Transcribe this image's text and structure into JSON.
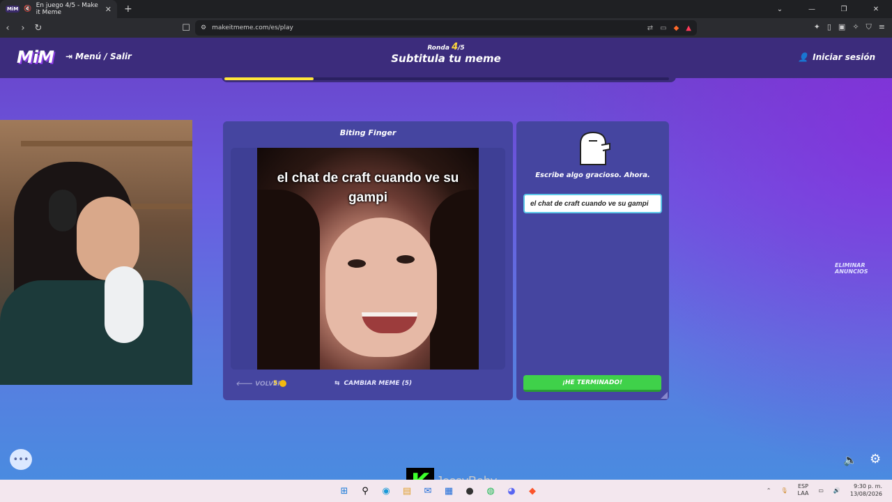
{
  "browser": {
    "tab": {
      "favicon": "MiM",
      "title": "En juego 4/5 - Make it Meme"
    },
    "url": "makeitmeme.com/es/play"
  },
  "header": {
    "logo": "MiM",
    "menu_label": "Menú / Salir",
    "round_prefix": "Ronda",
    "round_current": "4",
    "round_total": "/5",
    "stage_title": "Subtitula tu meme",
    "login_label": "Iniciar sesión",
    "progress_fraction": 0.2
  },
  "meme": {
    "template_name": "Biting Finger",
    "caption": "el chat de craft cuando ve su gampi",
    "back_label": "VOLVER",
    "coins": "5",
    "change_label": "CAMBIAR MEME (5)"
  },
  "writer": {
    "prompt": "Escribe algo gracioso. Ahora.",
    "input_value": "el chat de craft cuando ve su gampi",
    "done_label": "¡HE TERMINADO!"
  },
  "ads": {
    "remove_label": "ELIMINAR ANUNCIOS"
  },
  "stream_overlay": {
    "logo_letter": "K",
    "name": "JessyBaby"
  },
  "taskbar": {
    "lang_1": "ESP",
    "lang_2": "LAA",
    "time": "9:30 p. m.",
    "date": "13/08/2026"
  },
  "colors": {
    "accent_yellow": "#ffe63a",
    "button_green": "#3fd14a",
    "panel_blue": "#4545a0",
    "topbar_purple": "#3c2c7c"
  }
}
